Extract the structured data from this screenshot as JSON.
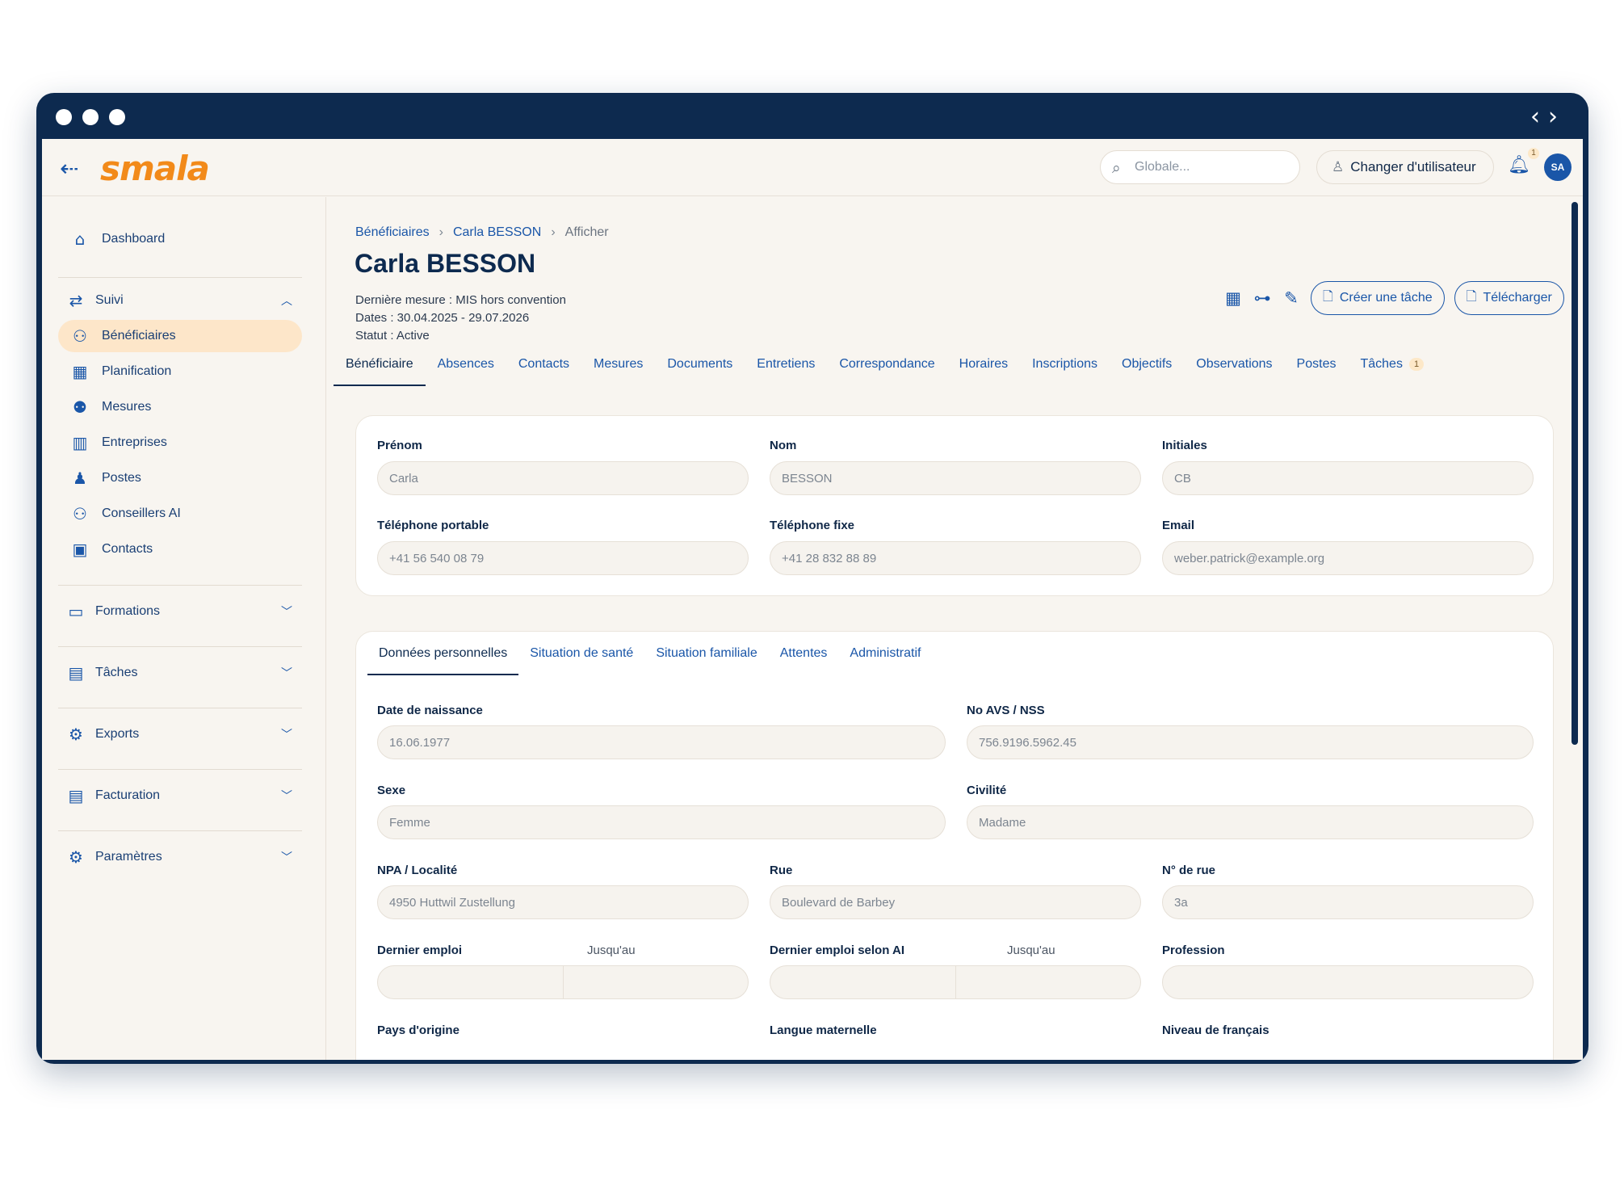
{
  "app": {
    "logo": "smala",
    "search": {
      "placeholder": "Globale..."
    },
    "switch_user": "Changer d'utilisateur",
    "notifications": "1",
    "avatar": "SA"
  },
  "sidebar": {
    "dashboard": "Dashboard",
    "suivi": "Suivi",
    "items": [
      "Bénéficiaires",
      "Planification",
      "Mesures",
      "Entreprises",
      "Postes",
      "Conseillers AI",
      "Contacts"
    ],
    "sections": [
      "Formations",
      "Tâches",
      "Exports",
      "Facturation",
      "Paramètres"
    ]
  },
  "page": {
    "breadcrumb": [
      "Bénéficiaires",
      "Carla BESSON",
      "Afficher"
    ],
    "title": "Carla BESSON",
    "last_measure": "Dernière mesure : MIS hors convention",
    "dates": "Dates : 30.04.2025 - 29.07.2026",
    "status": "Statut : Active",
    "create_task": "Créer une tâche",
    "download": "Télécharger"
  },
  "tabs": [
    "Bénéficiaire",
    "Absences",
    "Contacts",
    "Mesures",
    "Documents",
    "Entretiens",
    "Correspondance",
    "Horaires",
    "Inscriptions",
    "Objectifs",
    "Observations",
    "Postes",
    "Tâches"
  ],
  "tasks_badge": "1",
  "identity": {
    "prenom_label": "Prénom",
    "prenom": "Carla",
    "nom_label": "Nom",
    "nom": "BESSON",
    "initiales_label": "Initiales",
    "initiales": "CB",
    "tel_mobile_label": "Téléphone portable",
    "tel_mobile": "+41 56 540 08 79",
    "tel_fixe_label": "Téléphone fixe",
    "tel_fixe": "+41 28 832 88 89",
    "email_label": "Email",
    "email": "weber.patrick@example.org"
  },
  "subtabs": [
    "Données personnelles",
    "Situation de santé",
    "Situation familiale",
    "Attentes",
    "Administratif"
  ],
  "personal": {
    "birth_label": "Date de naissance",
    "birth": "16.06.1977",
    "avs_label": "No AVS / NSS",
    "avs": "756.9196.5962.45",
    "sexe_label": "Sexe",
    "sexe": "Femme",
    "civilite_label": "Civilité",
    "civilite": "Madame",
    "npa_label": "NPA / Localité",
    "npa": "4950 Huttwil Zustellung",
    "rue_label": "Rue",
    "rue": "Boulevard de Barbey",
    "no_rue_label": "N° de rue",
    "no_rue": "3a",
    "dernier_emploi_label": "Dernier emploi",
    "jusquau_label": "Jusqu'au",
    "dernier_emploi_ai_label": "Dernier emploi selon AI",
    "profession_label": "Profession",
    "pays_label": "Pays d'origine",
    "langue_label": "Langue maternelle",
    "niveau_label": "Niveau de français"
  }
}
